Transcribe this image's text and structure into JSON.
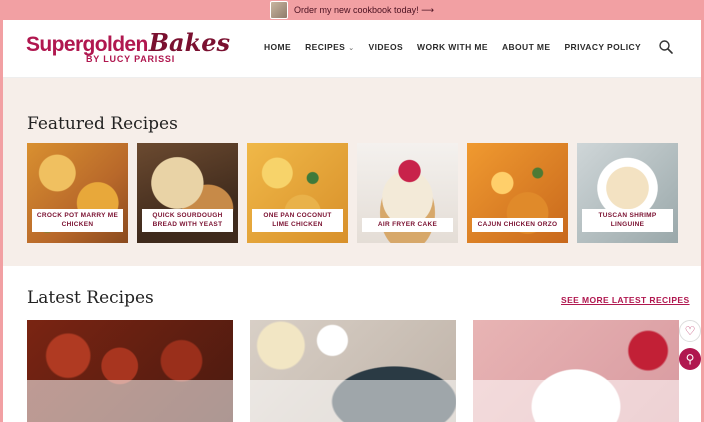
{
  "promo": {
    "text": "Order my new cookbook today! ⟶"
  },
  "logo": {
    "brand_main": "Supergolden",
    "brand_script": "Bakes",
    "byline": "BY LUCY PARISSI"
  },
  "nav": {
    "items": [
      "HOME",
      "RECIPES",
      "VIDEOS",
      "WORK WITH ME",
      "ABOUT ME",
      "PRIVACY POLICY"
    ]
  },
  "featured": {
    "heading": "Featured Recipes",
    "cards": [
      {
        "label": "CROCK POT MARRY ME CHICKEN"
      },
      {
        "label": "QUICK SOURDOUGH BREAD WITH YEAST"
      },
      {
        "label": "ONE PAN COCONUT LIME CHICKEN"
      },
      {
        "label": "AIR FRYER CAKE"
      },
      {
        "label": "CAJUN CHICKEN ORZO"
      },
      {
        "label": "TUSCAN SHRIMP LINGUINE"
      }
    ]
  },
  "latest": {
    "heading": "Latest Recipes",
    "see_more": "SEE MORE LATEST RECIPES"
  },
  "colors": {
    "brand": "#b0174f",
    "brand_dark": "#7a1030",
    "promo_bar": "#f2a0a3",
    "featured_bg": "#f6eee9"
  },
  "icons": {
    "search": "search-icon",
    "favorite": "heart-icon",
    "recipe_finder": "magnifier-icon"
  }
}
